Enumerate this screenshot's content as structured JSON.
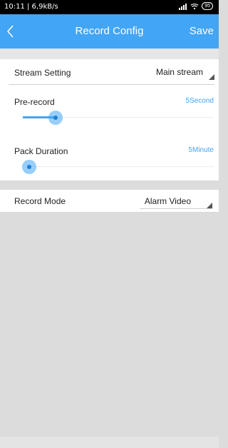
{
  "status_bar": {
    "time": "10:11 | 6,9kB/s",
    "battery": "95"
  },
  "app_bar": {
    "title": "Record Config",
    "save_label": "Save"
  },
  "stream_setting": {
    "label": "Stream Setting",
    "value": "Main stream"
  },
  "pre_record": {
    "label": "Pre-record",
    "value": "5Second",
    "level": 0.17
  },
  "pack_duration": {
    "label": "Pack Duration",
    "value": "5Minute",
    "level": 0.0
  },
  "record_mode": {
    "label": "Record Mode",
    "value": "Alarm Video"
  },
  "colors": {
    "accent": "#42a5f5",
    "background": "#dcdcdc"
  }
}
